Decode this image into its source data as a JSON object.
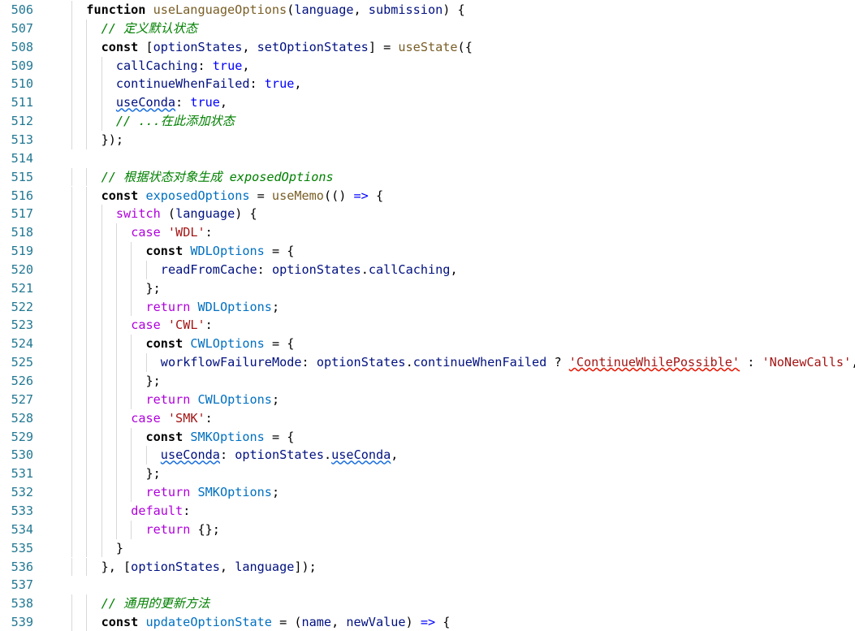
{
  "editor": {
    "line_numbers": [
      "506",
      "507",
      "508",
      "509",
      "510",
      "511",
      "512",
      "513",
      "514",
      "515",
      "516",
      "517",
      "518",
      "519",
      "520",
      "521",
      "522",
      "523",
      "524",
      "525",
      "526",
      "527",
      "528",
      "529",
      "530",
      "531",
      "532",
      "533",
      "534",
      "535",
      "536",
      "537",
      "538",
      "539"
    ]
  },
  "lines": [
    [
      [
        "function ",
        "kd"
      ],
      [
        "useLanguageOptions",
        "fn"
      ],
      [
        "(",
        "pn"
      ],
      [
        "language",
        "vr"
      ],
      [
        ", ",
        "pn"
      ],
      [
        "submission",
        "vr"
      ],
      [
        ") {",
        "pn"
      ]
    ],
    [
      [
        "// 定义默认状态",
        "cm"
      ]
    ],
    [
      [
        "const ",
        "kd"
      ],
      [
        "[",
        "pn"
      ],
      [
        "optionStates",
        "vr"
      ],
      [
        ", ",
        "pn"
      ],
      [
        "setOptionStates",
        "vr"
      ],
      [
        "] = ",
        "pn"
      ],
      [
        "useState",
        "fn"
      ],
      [
        "({",
        "pn"
      ]
    ],
    [
      [
        "callCaching",
        "vr"
      ],
      [
        ": ",
        "pn"
      ],
      [
        "true",
        "bool"
      ],
      [
        ",",
        "pn"
      ]
    ],
    [
      [
        "continueWhenFailed",
        "vr"
      ],
      [
        ": ",
        "pn"
      ],
      [
        "true",
        "bool"
      ],
      [
        ",",
        "pn"
      ]
    ],
    [
      [
        "useConda",
        "vr"
      ],
      [
        ": ",
        "pn"
      ],
      [
        "true",
        "bool"
      ],
      [
        ",",
        "pn"
      ]
    ],
    [
      [
        "// ...在此添加状态",
        "cm"
      ]
    ],
    [
      [
        "});",
        "pn"
      ]
    ],
    [],
    [
      [
        "// 根据状态对象生成 exposedOptions",
        "cm"
      ]
    ],
    [
      [
        "const ",
        "kd"
      ],
      [
        "exposedOptions",
        "cst"
      ],
      [
        " = ",
        "pn"
      ],
      [
        "useMemo",
        "fn"
      ],
      [
        "(() ",
        "pn"
      ],
      [
        "=>",
        "kw"
      ],
      [
        " {",
        "pn"
      ]
    ],
    [
      [
        "switch",
        "ctrl"
      ],
      [
        " (",
        "pn"
      ],
      [
        "language",
        "vr"
      ],
      [
        ") {",
        "pn"
      ]
    ],
    [
      [
        "case ",
        "ctrl"
      ],
      [
        "'WDL'",
        "str"
      ],
      [
        ":",
        "pn"
      ]
    ],
    [
      [
        "const ",
        "kd"
      ],
      [
        "WDLOptions",
        "cst"
      ],
      [
        " = {",
        "pn"
      ]
    ],
    [
      [
        "readFromCache",
        "vr"
      ],
      [
        ": ",
        "pn"
      ],
      [
        "optionStates",
        "vr"
      ],
      [
        ".",
        "pn"
      ],
      [
        "callCaching",
        "vr"
      ],
      [
        ",",
        "pn"
      ]
    ],
    [
      [
        "};",
        "pn"
      ]
    ],
    [
      [
        "return ",
        "ctrl"
      ],
      [
        "WDLOptions",
        "cst"
      ],
      [
        ";",
        "pn"
      ]
    ],
    [
      [
        "case ",
        "ctrl"
      ],
      [
        "'CWL'",
        "str"
      ],
      [
        ":",
        "pn"
      ]
    ],
    [
      [
        "const ",
        "kd"
      ],
      [
        "CWLOptions",
        "cst"
      ],
      [
        " = {",
        "pn"
      ]
    ],
    [
      [
        "workflowFailureMode",
        "vr"
      ],
      [
        ": ",
        "pn"
      ],
      [
        "optionStates",
        "vr"
      ],
      [
        ".",
        "pn"
      ],
      [
        "continueWhenFailed",
        "vr"
      ],
      [
        " ? ",
        "pn"
      ],
      [
        "'ContinueWhilePossible'",
        "str"
      ],
      [
        " : ",
        "pn"
      ],
      [
        "'NoNewCalls'",
        "str"
      ],
      [
        ",",
        "pn"
      ]
    ],
    [
      [
        "};",
        "pn"
      ]
    ],
    [
      [
        "return ",
        "ctrl"
      ],
      [
        "CWLOptions",
        "cst"
      ],
      [
        ";",
        "pn"
      ]
    ],
    [
      [
        "case ",
        "ctrl"
      ],
      [
        "'SMK'",
        "str"
      ],
      [
        ":",
        "pn"
      ]
    ],
    [
      [
        "const ",
        "kd"
      ],
      [
        "SMKOptions",
        "cst"
      ],
      [
        " = {",
        "pn"
      ]
    ],
    [
      [
        "useConda",
        "vr"
      ],
      [
        ": ",
        "pn"
      ],
      [
        "optionStates",
        "vr"
      ],
      [
        ".",
        "pn"
      ],
      [
        "useConda",
        "vr"
      ],
      [
        ",",
        "pn"
      ]
    ],
    [
      [
        "};",
        "pn"
      ]
    ],
    [
      [
        "return ",
        "ctrl"
      ],
      [
        "SMKOptions",
        "cst"
      ],
      [
        ";",
        "pn"
      ]
    ],
    [
      [
        "default",
        "ctrl"
      ],
      [
        ":",
        "pn"
      ]
    ],
    [
      [
        "return ",
        "ctrl"
      ],
      [
        "{};",
        "pn"
      ]
    ],
    [
      [
        "}",
        "pn"
      ]
    ],
    [
      [
        "}, [",
        "pn"
      ],
      [
        "optionStates",
        "vr"
      ],
      [
        ", ",
        "pn"
      ],
      [
        "language",
        "vr"
      ],
      [
        "]);",
        "pn"
      ]
    ],
    [],
    [
      [
        "// 通用的更新方法",
        "cm"
      ]
    ],
    [
      [
        "const ",
        "kd"
      ],
      [
        "updateOptionState",
        "cst"
      ],
      [
        " = (",
        "pn"
      ],
      [
        "name",
        "vr"
      ],
      [
        ", ",
        "pn"
      ],
      [
        "newValue",
        "vr"
      ],
      [
        ") ",
        "pn"
      ],
      [
        "=>",
        "kw"
      ],
      [
        " {",
        "pn"
      ]
    ]
  ]
}
